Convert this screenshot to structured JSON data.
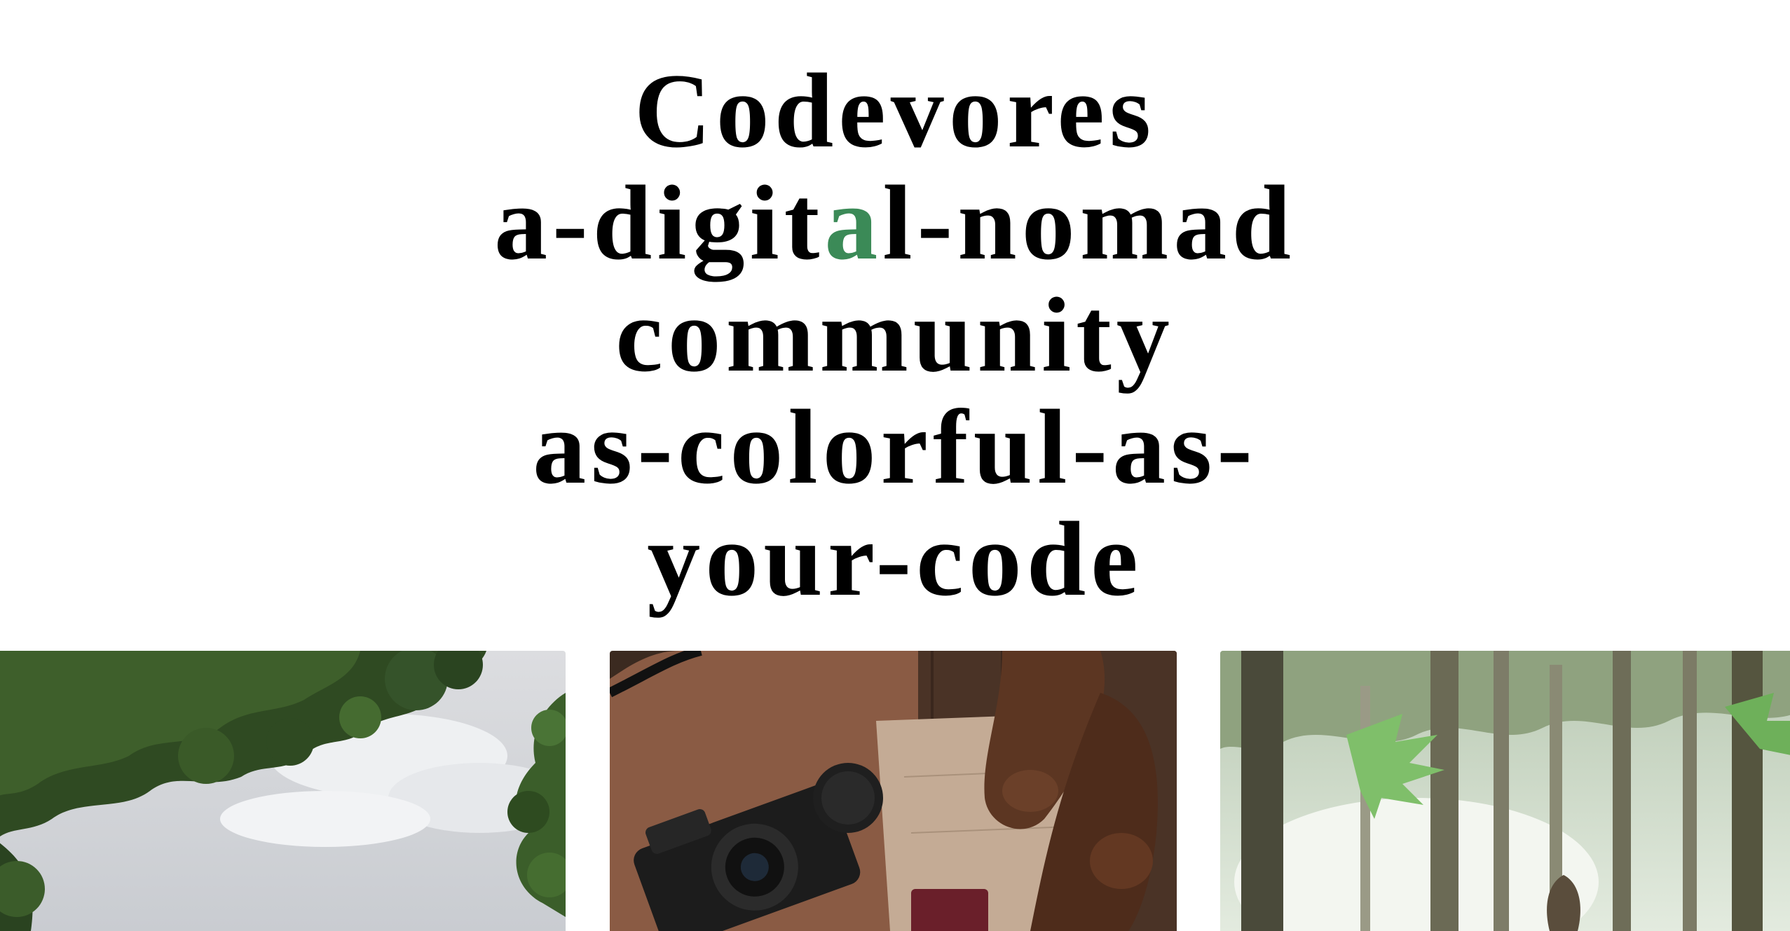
{
  "hero": {
    "line1": "Codevores",
    "line2_before": "a-digit",
    "line2_accent": "a",
    "line2_after": "l-nomad",
    "line3": "community",
    "line4": "as-colorful-as-",
    "line5": "your-code",
    "accent_color": "#3b8a57"
  },
  "gallery": {
    "images": [
      {
        "subject": "tree canopy and sky photo"
      },
      {
        "subject": "camera, lens cap, passport, map and leather shoes photo"
      },
      {
        "subject": "forest with ferns and tall trees photo"
      }
    ]
  }
}
